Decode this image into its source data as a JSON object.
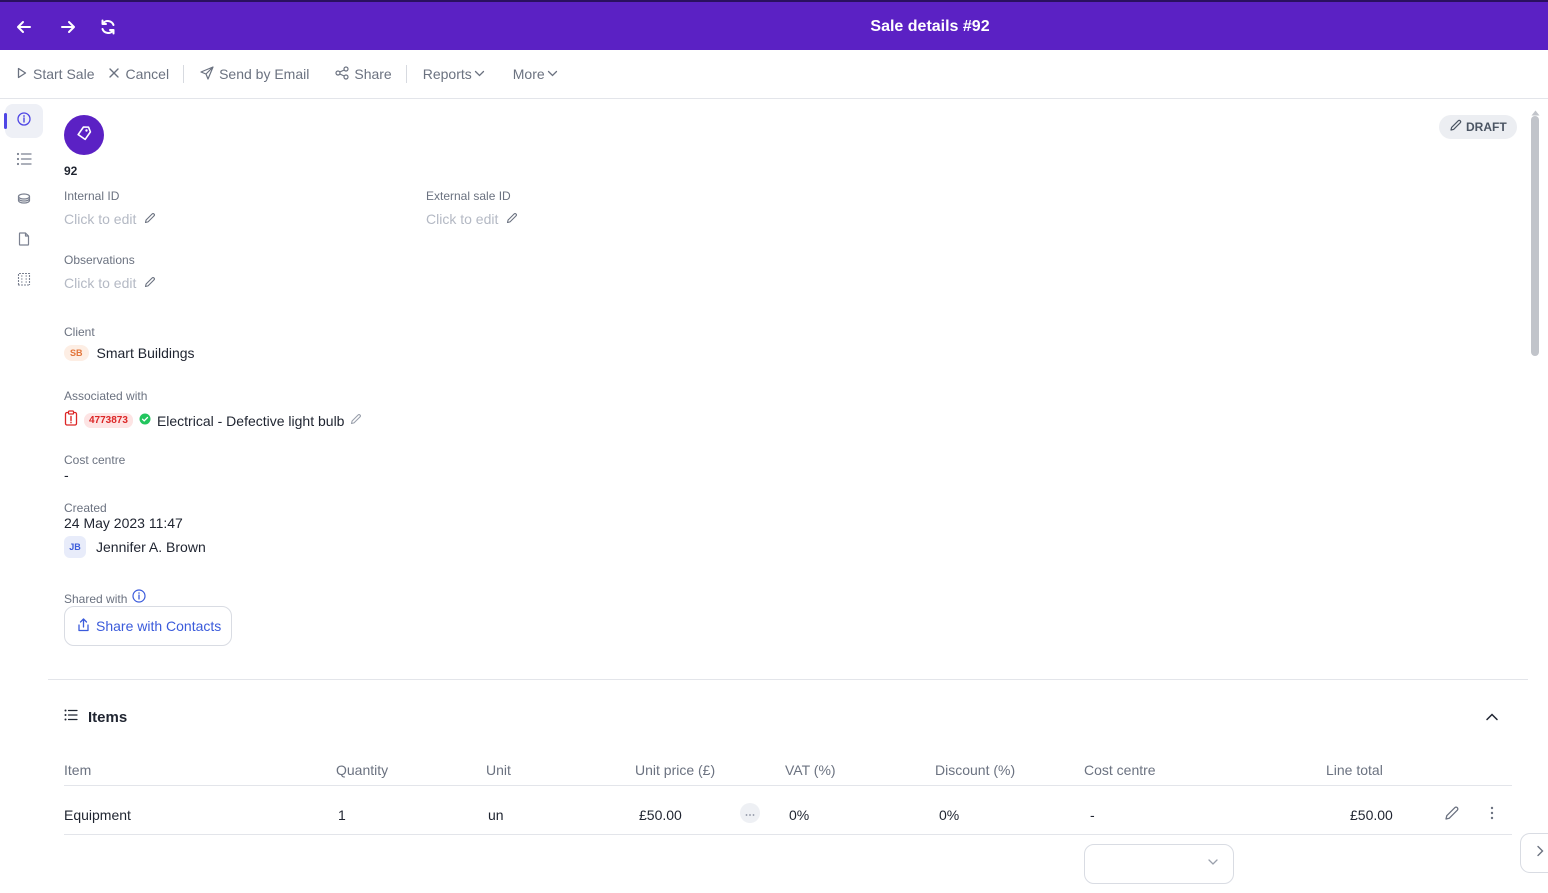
{
  "window": {
    "title": "Sale details #92"
  },
  "toolbar": {
    "start_sale": "Start Sale",
    "cancel": "Cancel",
    "send_by_email": "Send by Email",
    "share": "Share",
    "reports": "Reports",
    "more": "More"
  },
  "sidebar": {
    "items": [
      {
        "icon": "info-icon",
        "active": true
      },
      {
        "icon": "list-icon",
        "active": false
      },
      {
        "icon": "coins-icon",
        "active": false
      },
      {
        "icon": "document-icon",
        "active": false
      },
      {
        "icon": "building-icon",
        "active": false
      }
    ]
  },
  "sale": {
    "number": "92",
    "status": "DRAFT",
    "internal_id_label": "Internal ID",
    "internal_id_placeholder": "Click to edit",
    "external_id_label": "External sale ID",
    "external_id_placeholder": "Click to edit",
    "observations_label": "Observations",
    "observations_placeholder": "Click to edit",
    "client_label": "Client",
    "client_initials": "SB",
    "client_name": "Smart Buildings",
    "associated_label": "Associated with",
    "associated_id": "4773873",
    "associated_name": "Electrical - Defective light bulb",
    "cost_centre_label": "Cost centre",
    "cost_centre_value": "-",
    "created_label": "Created",
    "created_date": "24 May 2023 11:47",
    "creator_initials": "JB",
    "creator_name": "Jennifer A. Brown",
    "shared_with_label": "Shared with",
    "share_button": "Share with Contacts"
  },
  "items": {
    "title": "Items",
    "columns": [
      "Item",
      "Quantity",
      "Unit",
      "Unit price (£)",
      "VAT (%)",
      "Discount (%)",
      "Cost centre",
      "Line total"
    ],
    "rows": [
      {
        "item": "Equipment",
        "quantity": "1",
        "unit": "un",
        "unit_price": "£50.00",
        "vat": "0%",
        "discount": "0%",
        "cost_centre": "-",
        "line_total": "£50.00"
      }
    ]
  },
  "colors": {
    "brand": "#5b21c4",
    "accent": "#3b5bdb",
    "status_red": "#dc2626",
    "status_green": "#22c55e"
  }
}
